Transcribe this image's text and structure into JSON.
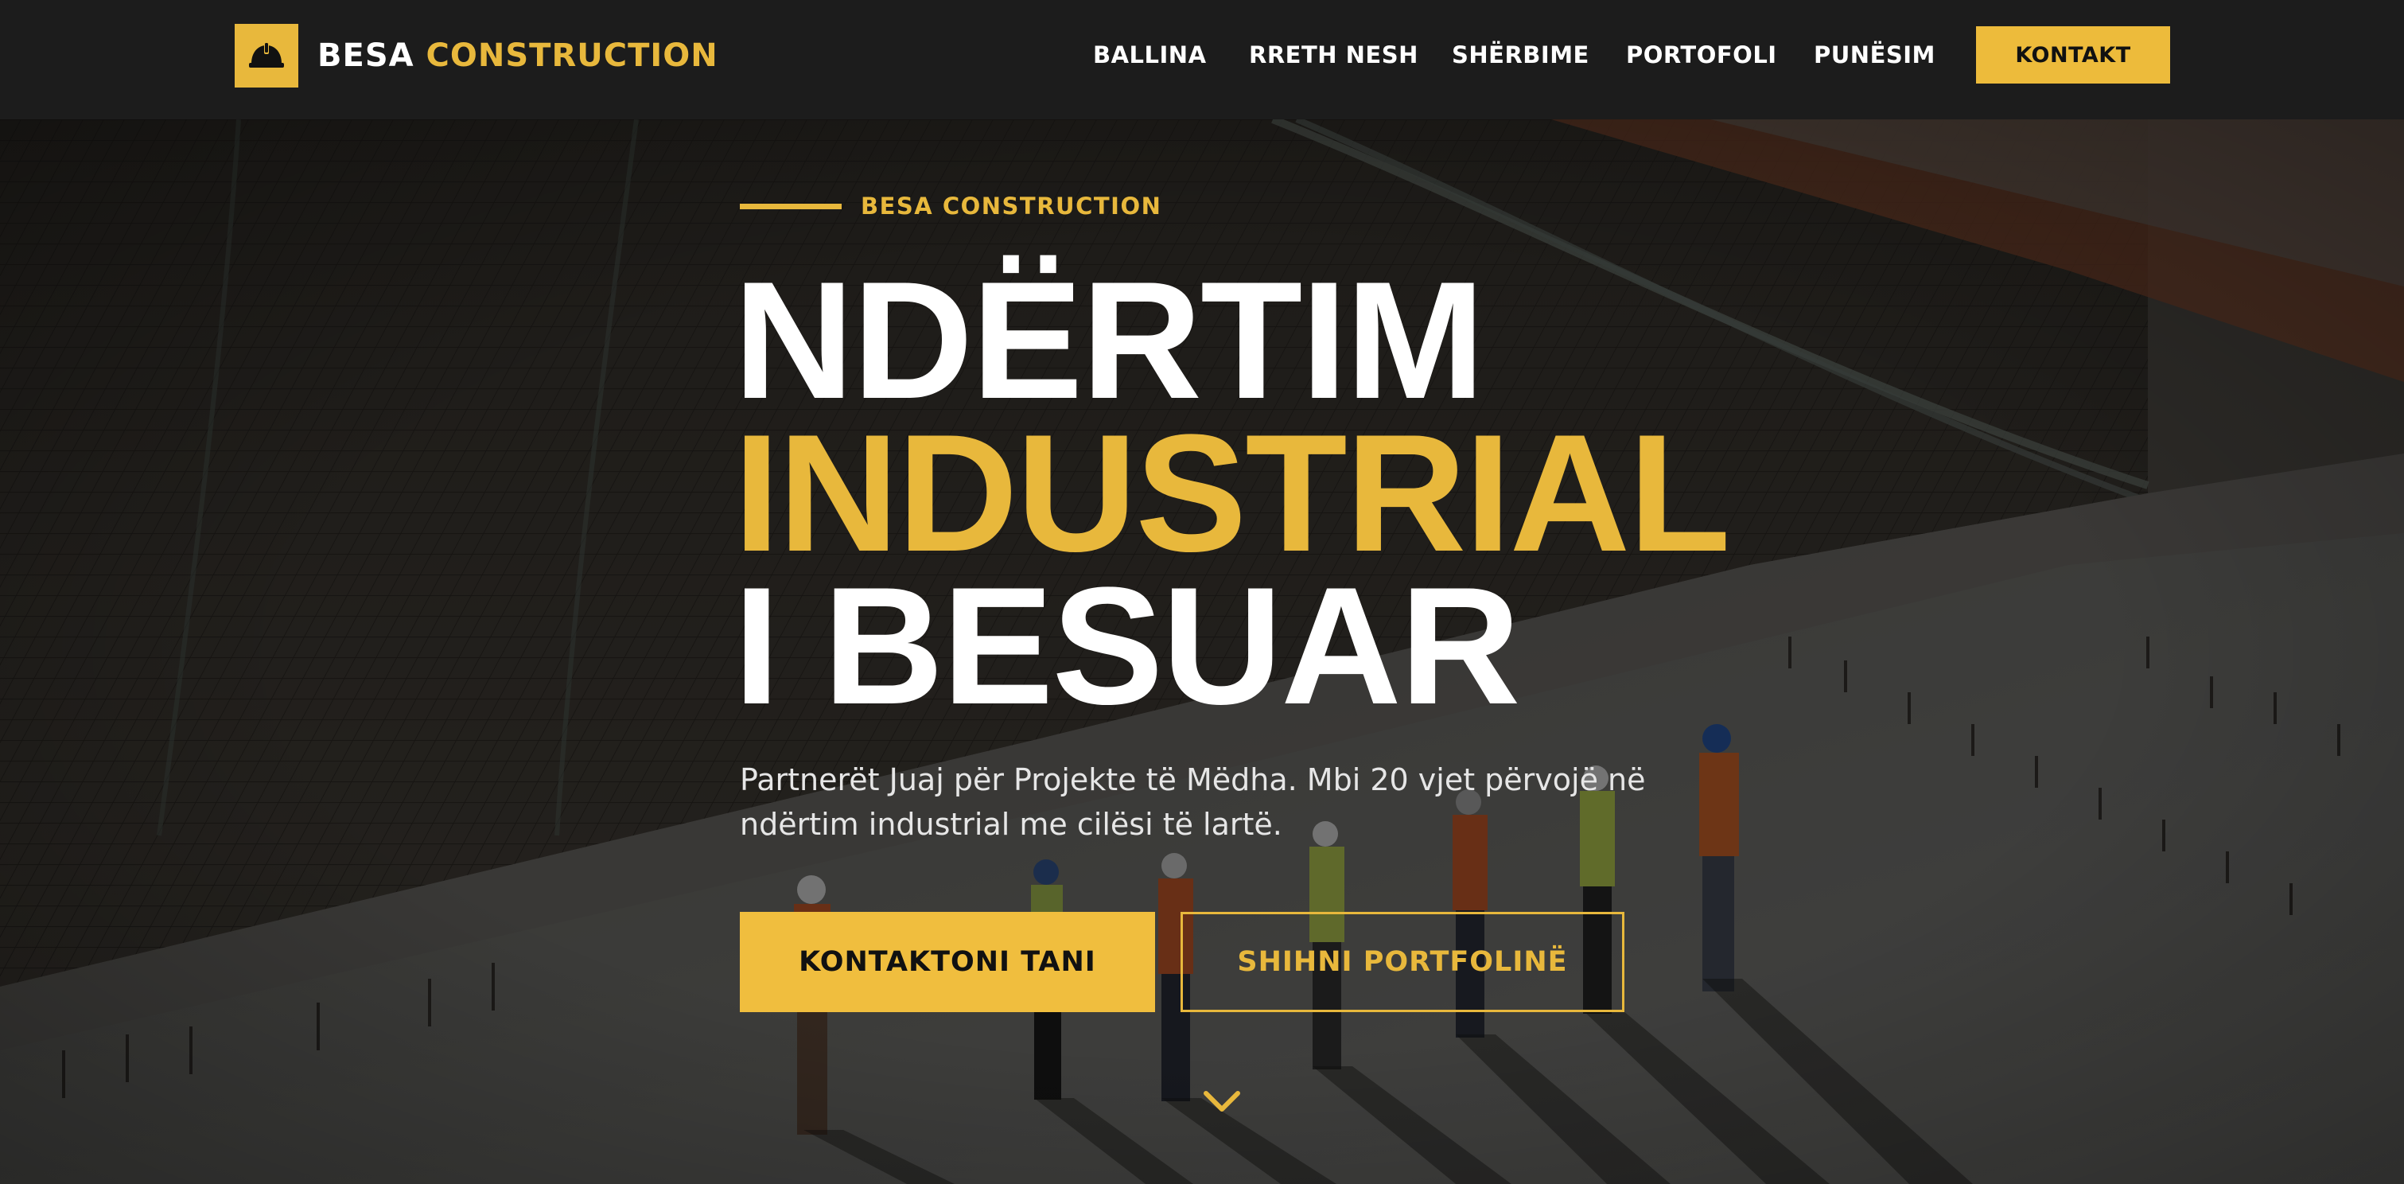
{
  "brand": {
    "name_part1": "BESA",
    "name_part2": "CONSTRUCTION",
    "logo_icon": "hard-hat-icon",
    "accent_color": "#e8b83c"
  },
  "nav": {
    "items": [
      {
        "label": "BALLINA"
      },
      {
        "label": "RRETH NESH"
      },
      {
        "label": "SHËRBIME"
      },
      {
        "label": "PORTOFOLI"
      },
      {
        "label": "PUNËSIM"
      }
    ],
    "cta_label": "KONTAKT"
  },
  "hero": {
    "eyebrow": "BESA CONSTRUCTION",
    "title_line1": "NDËRTIM",
    "title_line2": "INDUSTRIAL",
    "title_line3": "I BESUAR",
    "subtitle": "Partnerët Juaj për Projekte të Mëdha. Mbi 20 vjet përvojë në ndërtim industrial me cilësi të lartë.",
    "primary_button": "KONTAKTONI TANI",
    "secondary_button": "SHIHNI PORTFOLINË",
    "scroll_icon": "chevron-down-icon"
  },
  "colors": {
    "navbar_bg": "#1c1c1c",
    "accent": "#e8b83c",
    "button_primary": "#f0be3e",
    "text_light": "#ffffff"
  }
}
